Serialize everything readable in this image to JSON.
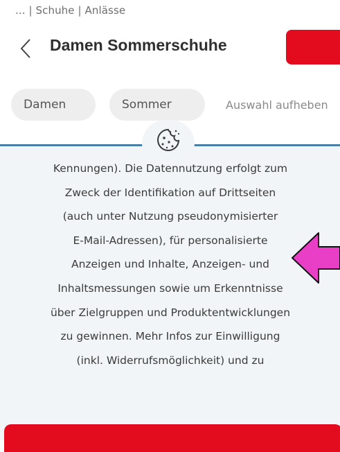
{
  "breadcrumb": "... | Schuhe | Anlässe",
  "header": {
    "title": "Damen Sommerschuhe",
    "back_icon": "chevron-left-icon",
    "action_color": "#e30b1e"
  },
  "filters": {
    "chips": [
      "Damen",
      "Sommer"
    ],
    "clear_label": "Auswahl aufheben"
  },
  "consent": {
    "icon": "cookie-icon",
    "lines": [
      "Kennungen). Die Datennutzung erfolgt zum",
      "Zweck der Identifikation auf Drittseiten",
      "(auch unter Nutzung pseudonymisierter",
      "E-Mail-Adressen), für personalisierte",
      "Anzeigen und Inhalte, Anzeigen- und",
      "Inhaltsmessungen sowie um Erkenntnisse",
      "über Zielgruppen und Produktentwicklungen",
      "zu gewinnen. Mehr Infos zur Einwilligung",
      "(inkl. Widerrufsmöglichkeit) und zu"
    ]
  },
  "annotation": {
    "icon": "arrow-left-icon",
    "color": "#e83fc6"
  },
  "colors": {
    "accent_red": "#e30b1e",
    "overlay_bg": "#f1f5f7",
    "overlay_line": "#4a7fa5"
  }
}
